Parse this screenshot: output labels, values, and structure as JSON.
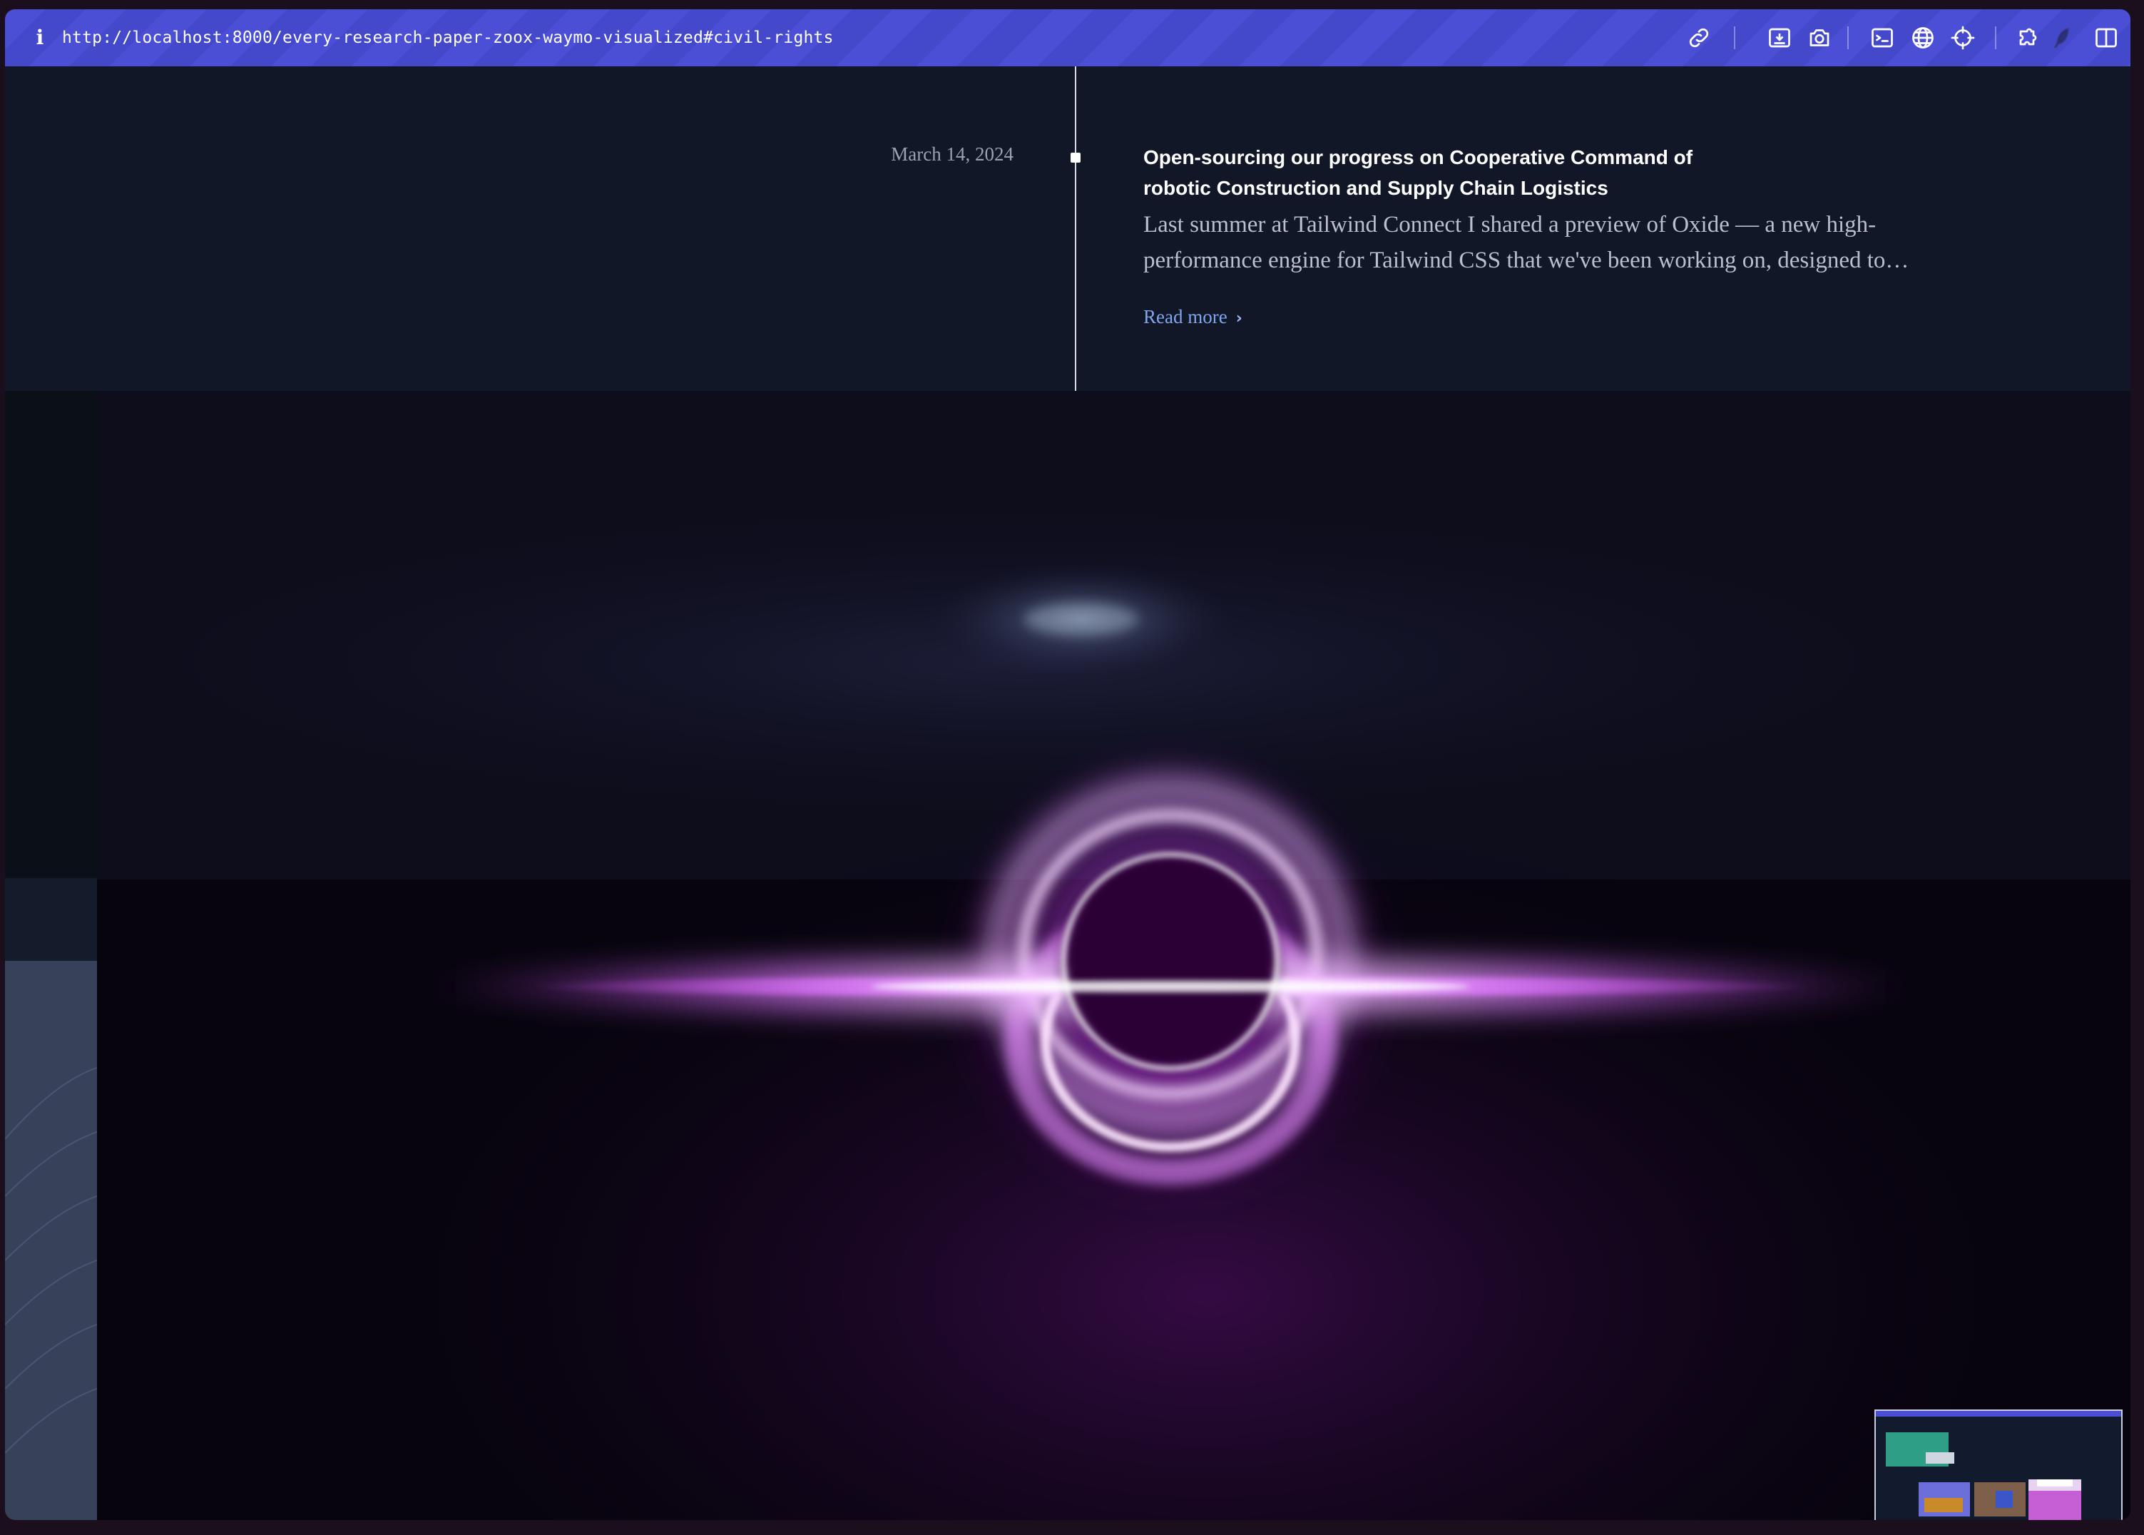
{
  "toolbar": {
    "info_label": "i",
    "url": "http://localhost:8000/every-research-paper-zoox-waymo-visualized#civil-rights",
    "icons": [
      "link-icon",
      "save-page-icon",
      "camera-icon",
      "terminal-icon",
      "globe-icon",
      "crosshair-icon",
      "extensions-icon",
      "feather-icon",
      "sidebar-toggle-icon"
    ]
  },
  "post": {
    "date": "March 14, 2024",
    "title": "Open-sourcing our progress on Cooperative Command of robotic Construction and Supply Chain Logistics",
    "excerpt": "Last summer at Tailwind Connect I shared a preview of Oxide — a new high-performance engine for Tailwind CSS that we've been working on, designed to…",
    "read_more": "Read more",
    "read_more_chevron": "›"
  },
  "hero": {
    "subject": "black-hole-accretion-disk-image",
    "glow_color": "#d64bff"
  },
  "colors": {
    "toolbar": "#4b4fd6",
    "page_background": "#121728",
    "link": "#7fa6ee"
  }
}
